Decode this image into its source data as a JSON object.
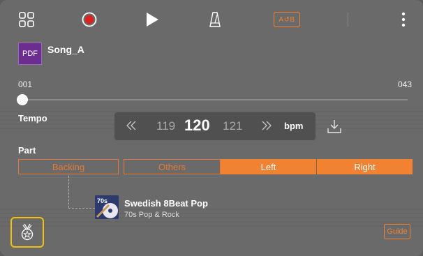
{
  "toolbar": {
    "grid_icon": "grid-icon",
    "record_icon": "record-icon",
    "play_icon": "play-icon",
    "metronome_icon": "metronome-icon",
    "ab_label": "A↺B",
    "more_icon": "more-vertical-icon"
  },
  "song": {
    "file_type": "PDF",
    "title": "Song_A"
  },
  "measures": {
    "start": "001",
    "end": "043",
    "position": 0
  },
  "tempo": {
    "label": "Tempo",
    "prev": "119",
    "current": "120",
    "next": "121",
    "unit": "bpm"
  },
  "part": {
    "label": "Part",
    "options": [
      "Backing",
      "Others",
      "Left",
      "Right"
    ],
    "selected": "Left"
  },
  "style": {
    "name": "Swedish 8Beat Pop",
    "genre": "70s Pop & Rock",
    "thumb_label": "70s"
  },
  "bottom": {
    "guide_label": "Guide"
  },
  "colors": {
    "accent": "#f08232",
    "badge_border": "#f3c010",
    "record": "#e0201f",
    "pdf": "#6b2d8f"
  }
}
